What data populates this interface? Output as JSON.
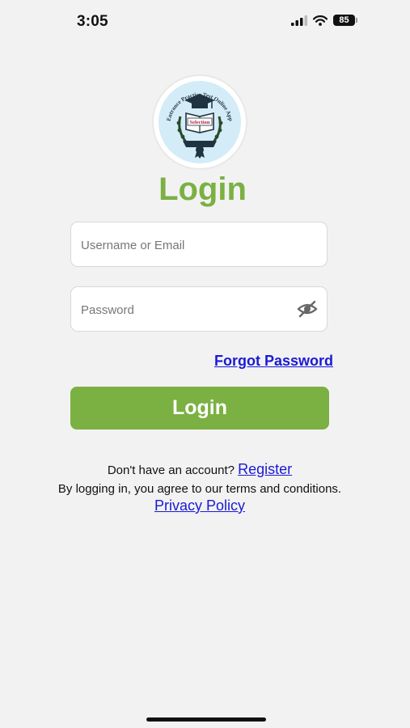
{
  "status_bar": {
    "time": "3:05",
    "battery": "85",
    "icons": [
      "signal-icon",
      "wifi-icon",
      "battery-icon"
    ]
  },
  "logo": {
    "icon": "school-crest-logo",
    "arc_text": "Entrance Practice Test Online App",
    "book_text": "Selection"
  },
  "title": "Login",
  "username_field": {
    "placeholder": "Username or Email",
    "value": ""
  },
  "password_field": {
    "placeholder": "Password",
    "value": "",
    "icon": "eye-off-icon"
  },
  "forgot_password": "Forgot Password",
  "login_button": "Login",
  "signup": {
    "prompt": "Don't have an account?",
    "link": "Register"
  },
  "terms": "By logging in, you agree to our terms and conditions.",
  "privacy_link": "Privacy Policy",
  "colors": {
    "accent": "#7bb043",
    "link": "#1a1ad6",
    "background": "#f2f2f2"
  }
}
